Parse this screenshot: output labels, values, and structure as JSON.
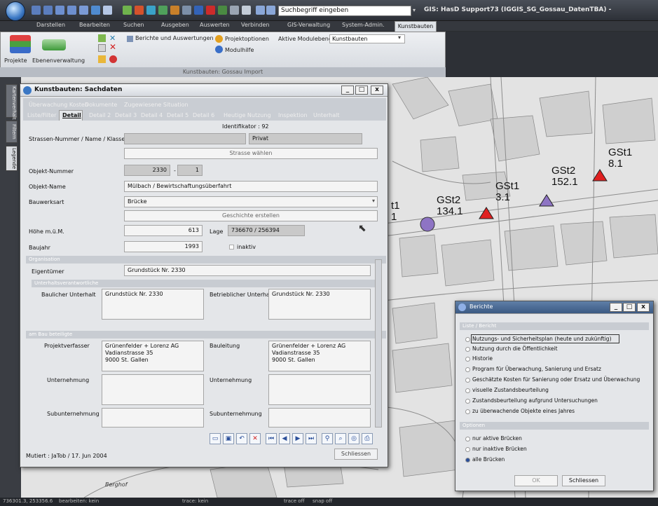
{
  "title_bar": {
    "search_placeholder": "Suchbegriff eingeben",
    "app_title": "GIS: HasD Support73 (IGGIS_SG_Gossau_DatenTBA) -"
  },
  "menu": [
    "Darstellen",
    "Bearbeiten",
    "Suchen",
    "Ausgeben",
    "Auswerten",
    "Verbinden",
    "GIS-Verwaltung",
    "System-Admin.",
    "Kunstbauten"
  ],
  "ribbon": {
    "projects": "Projekte",
    "layers": "Ebenenverwaltung",
    "reports": "Berichte und Auswertungen",
    "project_options": "Projektoptionen",
    "module_help": "Modulhilfe",
    "active_modules_label": "Aktive Modulebene",
    "active_module_value": "Kunstbauten",
    "group_footer": "Kunstbauten: Gossau Import"
  },
  "side_tabs": [
    "Kartenverhalt",
    "Filtern",
    "Legende"
  ],
  "sachdaten": {
    "title": "Kunstbauten: Sachdaten",
    "tabs_row1": [
      "Überwachung Kosten",
      "Dokumente",
      "Zugewiesene Situation"
    ],
    "tabs_row2": [
      "Liste/Filter",
      "Detail",
      "Detail 2",
      "Detail 3",
      "Detail 4",
      "Detail 5",
      "Detail 6",
      "Heutige Nutzung",
      "Inspektion",
      "Unterhalt"
    ],
    "identifier": "Identifikator : 92",
    "street_label": "Strassen-Nummer / Name / Klasse",
    "street_class": "Privat",
    "choose_street": "Strasse wählen",
    "objnum_label": "Objekt-Nummer",
    "objnum": "2330",
    "objnum_sep": "-",
    "objnum_sub": "1",
    "objname_label": "Objekt-Name",
    "objname": "Mülbach / Bewirtschaftungsüberfahrt",
    "type_label": "Bauwerksart",
    "type_value": "Brücke",
    "history": "Geschichte erstellen",
    "height_label": "Höhe m.ü.M.",
    "height": "613",
    "lage_label": "Lage",
    "lage": "736670 / 256394",
    "year_label": "Baujahr",
    "year": "1993",
    "inactive": "inaktiv",
    "org_section": "Organisation",
    "owner_label": "Eigentümer",
    "owner": "Grundstück Nr. 2330",
    "maint_section": "Unterhaltsverantwortliche",
    "structural_label": "Baulicher Unterhalt",
    "structural": "Grundstück Nr. 2330",
    "operational_label": "Betrieblicher Unterhalt",
    "operational": "Grundstück Nr. 2330",
    "involved_section": "am Bau beteiligte",
    "author_label": "Projektverfasser",
    "author_l1": "Grünenfelder + Lorenz AG",
    "author_l2": "Vadianstrasse 35",
    "author_l3": "9000 St. Gallen",
    "site_label": "Bauleitung",
    "site_l1": "Grünenfelder + Lorenz AG",
    "site_l2": "Vadianstrasse 35",
    "site_l3": "9000 St. Gallen",
    "contractor_label": "Unternehmung",
    "contractor2_label": "Unternehmung",
    "sub_label": "Subunternehmung",
    "sub2_label": "Subunternehmung",
    "mutiert": "Mutiert : JaTob / 17. Jun 2004",
    "close": "Schliessen"
  },
  "map_labels": {
    "gst1a_name": "GSt1",
    "gst1a_val": "8.1",
    "gst2a_name": "GSt2",
    "gst2a_val": "152.1",
    "gst1b_name": "GSt1",
    "gst1b_val": "3.1",
    "gst2b_name": "GSt2",
    "gst2b_val": "134.1",
    "edge_t1": "t1",
    "edge_1": "1",
    "place": "Berghof"
  },
  "berichte": {
    "title": "Berichte",
    "list_section": "Liste / Bericht",
    "options": [
      "Nutzungs- und Sicherheitsplan (heute und zukünftig)",
      "Nutzung durch die Öffentlichkeit",
      "Historie",
      "Program für Überwachung, Sanierung und Ersatz",
      "Geschätzte Kosten für Sanierung oder Ersatz und Überwachung",
      "visuelle Zustandsbeurteilung",
      "Zustandsbeurteilung aufgrund Untersuchungen",
      "zu überwachende Objekte eines Jahres"
    ],
    "opt_section": "Optionen",
    "filters": [
      "nur aktive Brücken",
      "nur inaktive Brücken",
      "alle Brücken"
    ],
    "ok": "OK",
    "close": "Schliessen"
  },
  "status": {
    "coords": "736301.3, 253356.6",
    "edit": "bearbeiten: kein",
    "trace": "trace: kein",
    "trace_off": "trace off",
    "snap_off": "snap off"
  },
  "colors": {
    "accent": "#3a77c4",
    "marker_red": "#e02020",
    "marker_purple": "#8e74c4"
  }
}
